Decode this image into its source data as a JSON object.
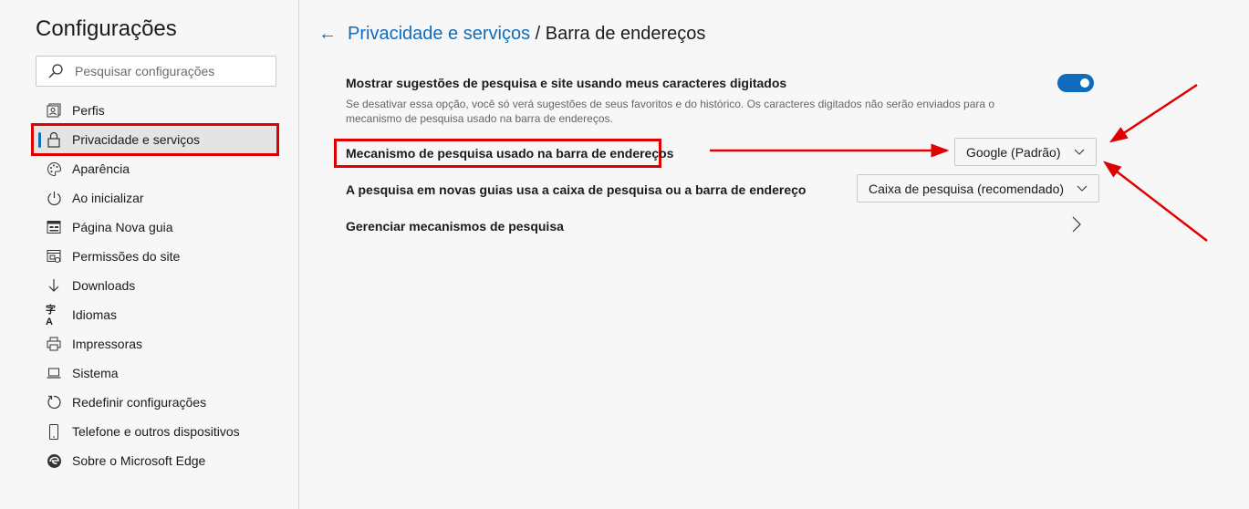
{
  "sidebar": {
    "title": "Configurações",
    "search_placeholder": "Pesquisar configurações",
    "items": [
      {
        "label": "Perfis",
        "icon": "profile-icon"
      },
      {
        "label": "Privacidade e serviços",
        "icon": "lock-icon",
        "active": true
      },
      {
        "label": "Aparência",
        "icon": "palette-icon"
      },
      {
        "label": "Ao inicializar",
        "icon": "power-icon"
      },
      {
        "label": "Página Nova guia",
        "icon": "new-tab-icon"
      },
      {
        "label": "Permissões do site",
        "icon": "site-permissions-icon"
      },
      {
        "label": "Downloads",
        "icon": "download-icon"
      },
      {
        "label": "Idiomas",
        "icon": "language-icon"
      },
      {
        "label": "Impressoras",
        "icon": "printer-icon"
      },
      {
        "label": "Sistema",
        "icon": "laptop-icon"
      },
      {
        "label": "Redefinir configurações",
        "icon": "reset-icon"
      },
      {
        "label": "Telefone e outros dispositivos",
        "icon": "phone-icon"
      },
      {
        "label": "Sobre o Microsoft Edge",
        "icon": "edge-logo-icon"
      }
    ]
  },
  "header": {
    "parent": "Privacidade e serviços",
    "separator": " / ",
    "current": "Barra de endereços"
  },
  "settings": {
    "suggestions": {
      "label": "Mostrar sugestões de pesquisa e site usando meus caracteres digitados",
      "description": "Se desativar essa opção, você só verá sugestões de seus favoritos e do histórico. Os caracteres digitados não serão enviados para o mecanismo de pesquisa usado na barra de endereços.",
      "enabled": true
    },
    "engine": {
      "label": "Mecanismo de pesquisa usado na barra de endereços",
      "value": "Google (Padrão)"
    },
    "new_tab": {
      "label": "A pesquisa em novas guias usa a caixa de pesquisa ou a barra de endereço",
      "value": "Caixa de pesquisa (recomendado)"
    },
    "manage": {
      "label": "Gerenciar mecanismos de pesquisa"
    }
  },
  "colors": {
    "accent": "#0f6cbd",
    "annotation": "#e00000"
  }
}
